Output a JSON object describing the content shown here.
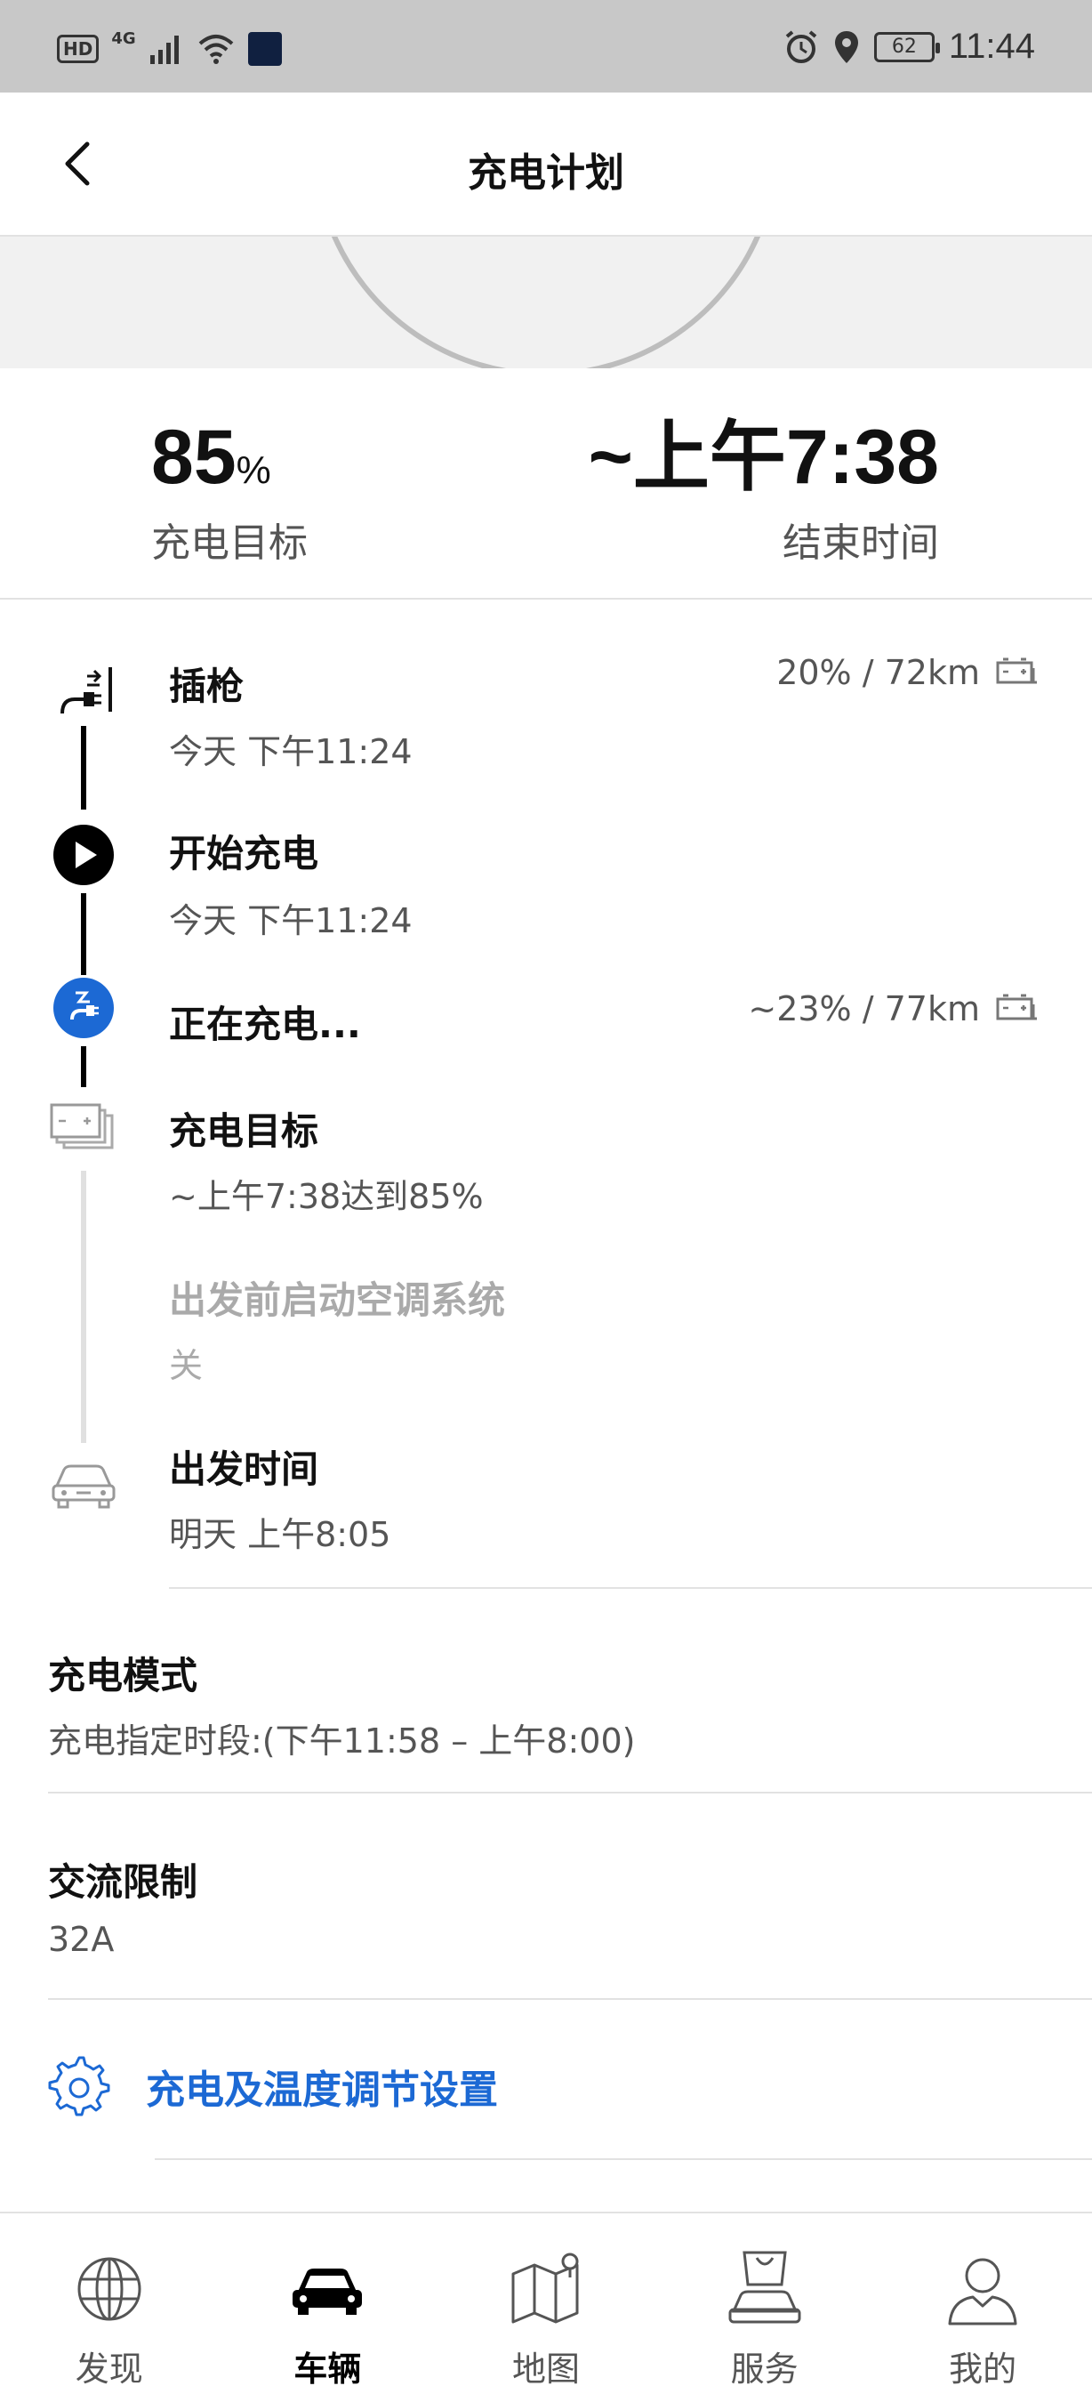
{
  "status_bar": {
    "left": {
      "hd": "HD",
      "network": "4G"
    },
    "battery": "62",
    "time": "11:44"
  },
  "header": {
    "title": "充电计划"
  },
  "summary": {
    "target_value": "85",
    "target_unit": "%",
    "target_label": "充电目标",
    "end_value": "~上午7:38",
    "end_label": "结束时间"
  },
  "timeline": {
    "plug": {
      "title": "插枪",
      "sub": "今天 下午11:24",
      "right": "20% / 72km"
    },
    "start": {
      "title": "开始充电",
      "sub": "今天 下午11:24"
    },
    "charging": {
      "title": "正在充电...",
      "right": "~23% / 77km"
    },
    "goal": {
      "title": "充电目标",
      "sub": "~上午7:38达到85%"
    },
    "climate": {
      "title": "出发前启动空调系统",
      "sub": "关"
    },
    "departure": {
      "title": "出发时间",
      "sub": "明天 上午8:05"
    }
  },
  "charge_mode": {
    "title": "充电模式",
    "value": "充电指定时段:(下午11:58 – 上午8:00)"
  },
  "ac_limit": {
    "title": "交流限制",
    "value": "32A"
  },
  "settings_link": {
    "label": "充电及温度调节设置"
  },
  "colors": {
    "accent": "#1c69d4",
    "text": "#111111",
    "muted": "#555555",
    "disabled": "#aaaaaa"
  },
  "bottom_nav": {
    "items": [
      {
        "label": "发现",
        "icon": "globe-icon"
      },
      {
        "label": "车辆",
        "icon": "car-icon",
        "active": true
      },
      {
        "label": "地图",
        "icon": "map-icon"
      },
      {
        "label": "服务",
        "icon": "service-icon"
      },
      {
        "label": "我的",
        "icon": "profile-icon"
      }
    ]
  }
}
